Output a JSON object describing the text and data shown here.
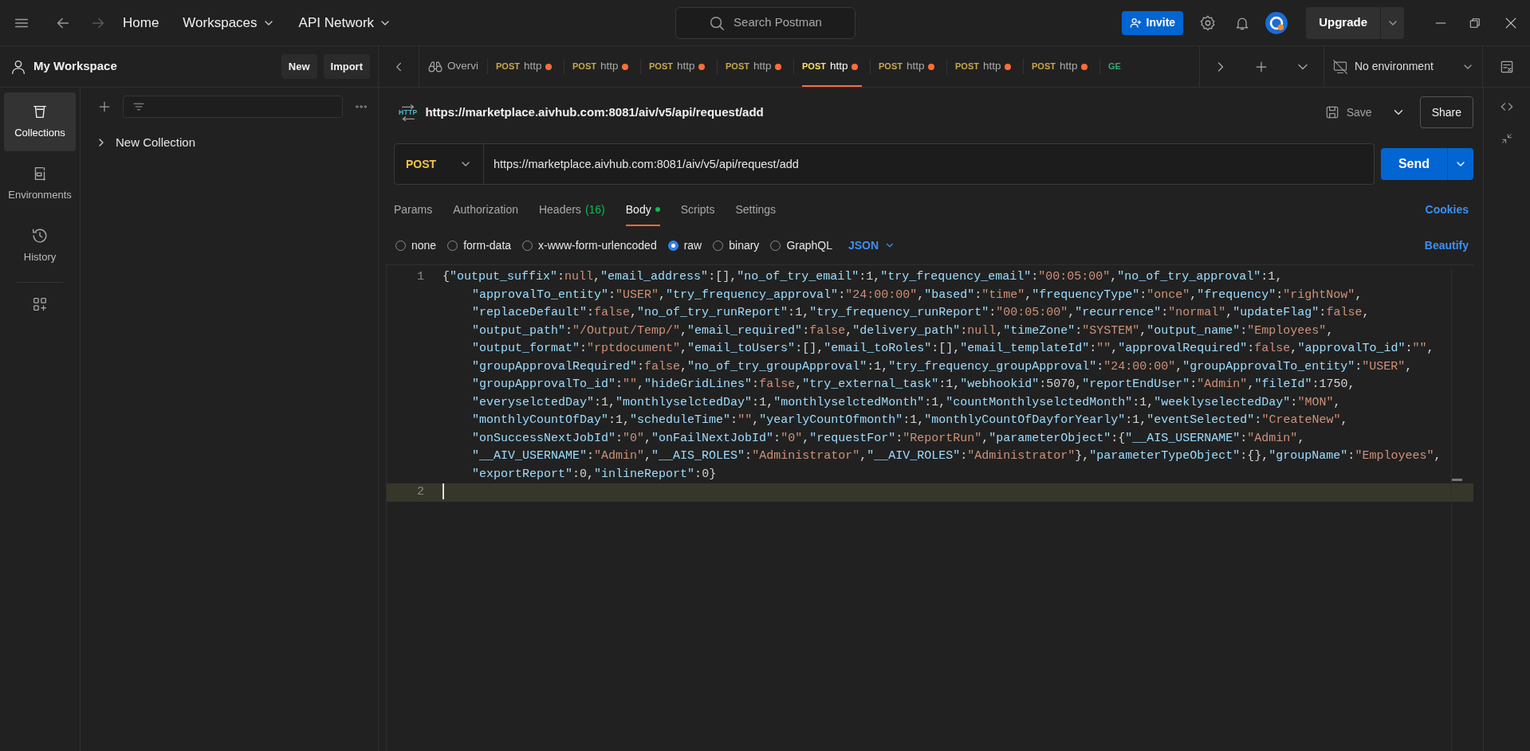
{
  "title_bar": {
    "nav": [
      {
        "label": "Home",
        "dropdown": false
      },
      {
        "label": "Workspaces",
        "dropdown": true
      },
      {
        "label": "API Network",
        "dropdown": true
      }
    ],
    "search": {
      "placeholder": "Search Postman"
    },
    "invite_button": "Invite",
    "upgrade_button": "Upgrade"
  },
  "sidebar": {
    "workspace": "My Workspace",
    "new_button": "New",
    "import_button": "Import",
    "rail": [
      {
        "label": "Collections",
        "selected": true
      },
      {
        "label": "Environments",
        "selected": false
      },
      {
        "label": "History",
        "selected": false
      }
    ],
    "tree": [
      {
        "label": "New Collection",
        "expanded": false
      }
    ]
  },
  "tabs": [
    {
      "kind": "overview",
      "label": "Overvi",
      "selected": false
    },
    {
      "kind": "request",
      "method": "POST",
      "color": "#c7a84a",
      "label": "http",
      "unsaved": true,
      "selected": false
    },
    {
      "kind": "request",
      "method": "POST",
      "color": "#c7a84a",
      "label": "http",
      "unsaved": true,
      "selected": false
    },
    {
      "kind": "request",
      "method": "POST",
      "color": "#c7a84a",
      "label": "http",
      "unsaved": true,
      "selected": false
    },
    {
      "kind": "request",
      "method": "POST",
      "color": "#c7a84a",
      "label": "http",
      "unsaved": true,
      "selected": false
    },
    {
      "kind": "request",
      "method": "POST",
      "color": "#c7a84a",
      "label": "http",
      "unsaved": true,
      "selected": true
    },
    {
      "kind": "request",
      "method": "POST",
      "color": "#c7a84a",
      "label": "http",
      "unsaved": true,
      "selected": false
    },
    {
      "kind": "request",
      "method": "POST",
      "color": "#c7a84a",
      "label": "http",
      "unsaved": true,
      "selected": false
    },
    {
      "kind": "request",
      "method": "POST",
      "color": "#c7a84a",
      "label": "http",
      "unsaved": true,
      "selected": false
    },
    {
      "kind": "request",
      "method": "GE",
      "color": "#3aa675",
      "selected": false
    }
  ],
  "environment": {
    "label": "No environment"
  },
  "request": {
    "protocol": "HTTP",
    "title": "https://marketplace.aivhub.com:8081/aiv/v5/api/request/add",
    "save_button": "Save",
    "share_button": "Share",
    "method": "POST",
    "url": "https://marketplace.aivhub.com:8081/aiv/v5/api/request/add",
    "send_button": "Send"
  },
  "request_tabs": [
    {
      "label": "Params",
      "selected": false
    },
    {
      "label": "Authorization",
      "selected": false
    },
    {
      "label": "Headers",
      "count": "(16)",
      "selected": false
    },
    {
      "label": "Body",
      "has_content": true,
      "selected": true
    },
    {
      "label": "Scripts",
      "selected": false
    },
    {
      "label": "Settings",
      "selected": false
    }
  ],
  "cookies_link": "Cookies",
  "body_types": [
    {
      "label": "none",
      "selected": false
    },
    {
      "label": "form-data",
      "selected": false
    },
    {
      "label": "x-www-form-urlencoded",
      "selected": false
    },
    {
      "label": "raw",
      "selected": true
    },
    {
      "label": "binary",
      "selected": false
    },
    {
      "label": "GraphQL",
      "selected": false
    }
  ],
  "body_language": "JSON",
  "beautify_link": "Beautify",
  "editor": {
    "lines": [
      {
        "number": "1",
        "current": false,
        "rows": [
          "{\"output_suffix\":null,\"email_address\":[],\"no_of_try_email\":1,\"try_frequency_email\":\"00:05:00\",\"no_of_try_approval\":1,",
          "\"approvalTo_entity\":\"USER\",\"try_frequency_approval\":\"24:00:00\",\"based\":\"time\",\"frequencyType\":\"once\",\"frequency\":\"rightNow\",",
          "\"replaceDefault\":false,\"no_of_try_runReport\":1,\"try_frequency_runReport\":\"00:05:00\",\"recurrence\":\"normal\",\"updateFlag\":false,",
          "\"output_path\":\"/Output/Temp/\",\"email_required\":false,\"delivery_path\":null,\"timeZone\":\"SYSTEM\",\"output_name\":\"Employees\",",
          "\"output_format\":\"rptdocument\",\"email_toUsers\":[],\"email_toRoles\":[],\"email_templateId\":\"\",\"approvalRequired\":false,\"approvalTo_id\":\"\",",
          "\"groupApprovalRequired\":false,\"no_of_try_groupApproval\":1,\"try_frequency_groupApproval\":\"24:00:00\",\"groupApprovalTo_entity\":\"USER\",",
          "\"groupApprovalTo_id\":\"\",\"hideGridLines\":false,\"try_external_task\":1,\"webhookid\":5070,\"reportEndUser\":\"Admin\",\"fileId\":1750,",
          "\"everyselctedDay\":1,\"monthlyselctedDay\":1,\"monthlyselctedMonth\":1,\"countMonthlyselctedMonth\":1,\"weeklyselectedDay\":\"MON\",",
          "\"monthlyCountOfDay\":1,\"scheduleTime\":\"\",\"yearlyCountOfmonth\":1,\"monthlyCountOfDayforYearly\":1,\"eventSelected\":\"CreateNew\",",
          "\"onSuccessNextJobId\":\"0\",\"onFailNextJobId\":\"0\",\"requestFor\":\"ReportRun\",\"parameterObject\":{\"__AIS_USERNAME\":\"Admin\",",
          "\"__AIV_USERNAME\":\"Admin\",\"__AIS_ROLES\":\"Administrator\",\"__AIV_ROLES\":\"Administrator\"},\"parameterTypeObject\":{},\"groupName\":\"Employees\",",
          "\"exportReport\":0,\"inlineReport\":0}"
        ]
      },
      {
        "number": "2",
        "current": true
      }
    ]
  }
}
